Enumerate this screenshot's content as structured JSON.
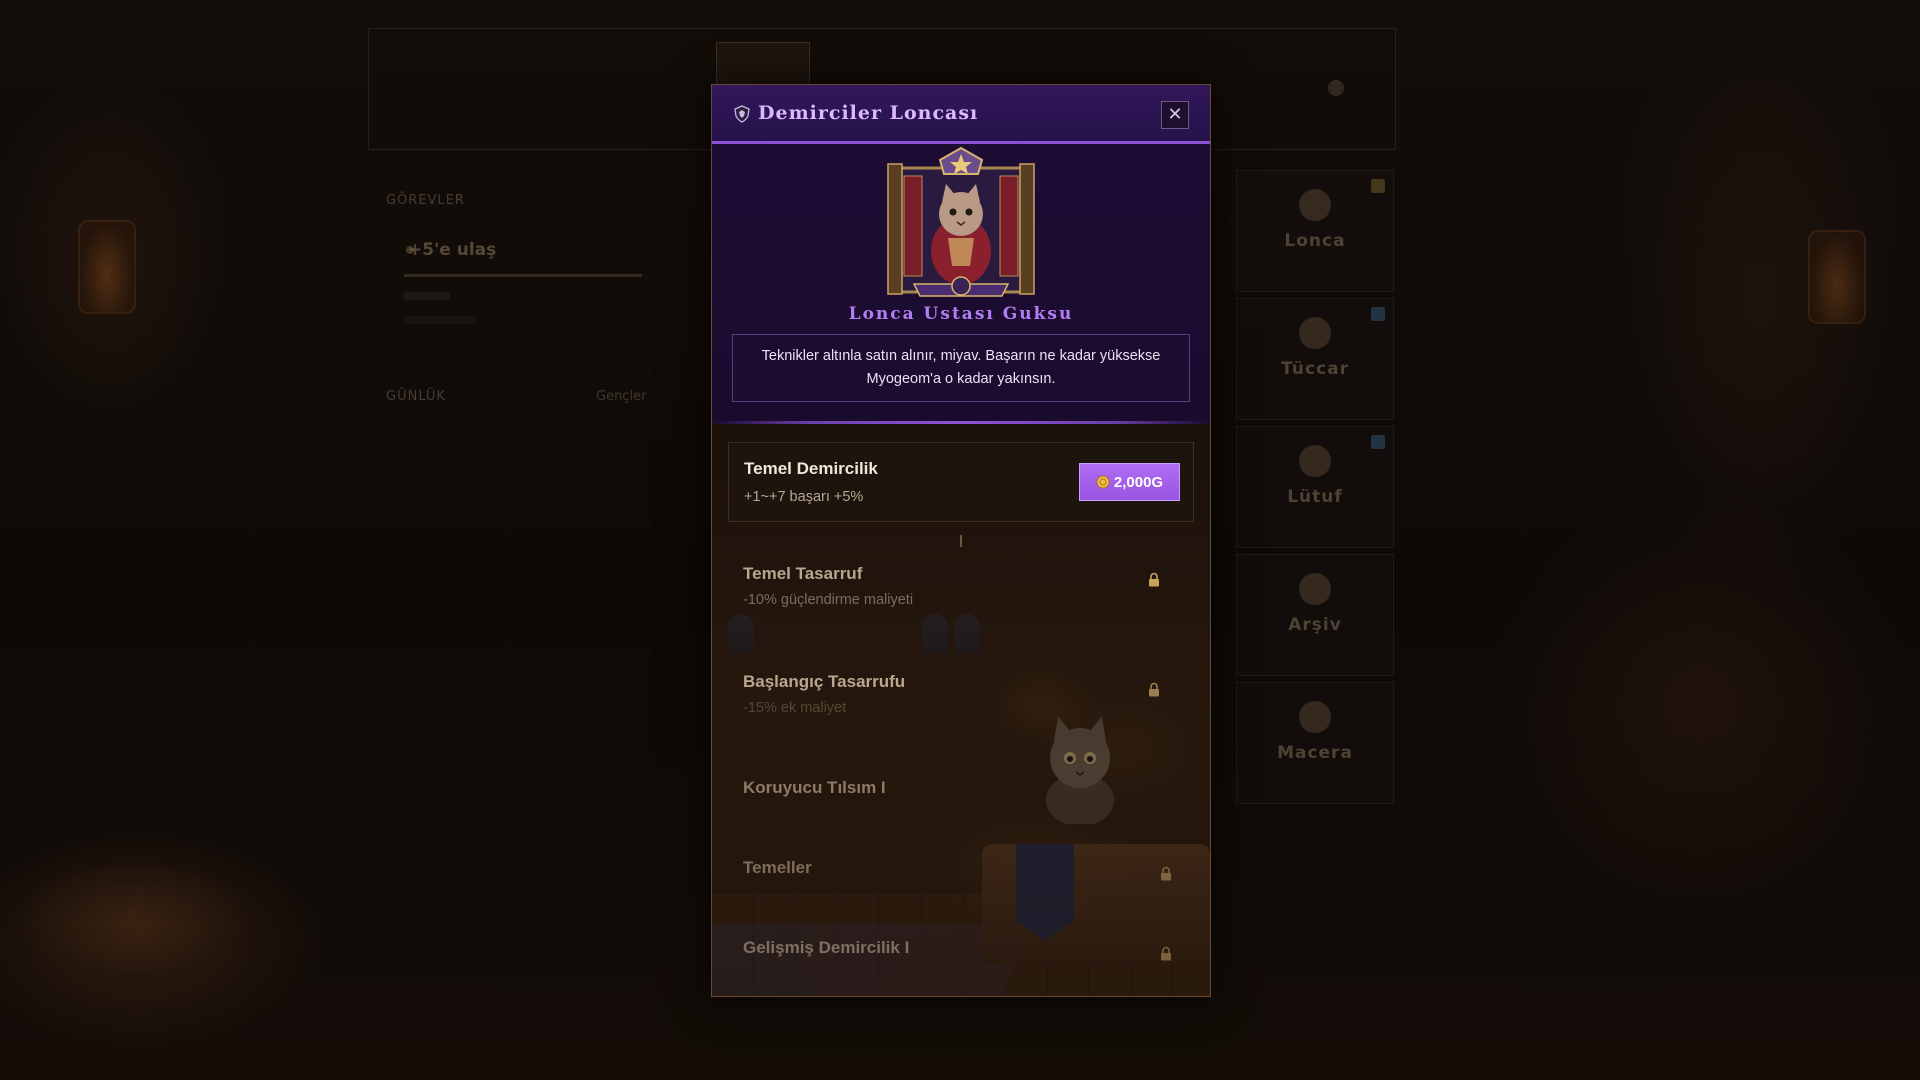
{
  "background": {
    "left_panel": {
      "quests_title": "GÖREVLER",
      "quest_text": "+5'e ulaş",
      "daily_title": "GÜNLÜK",
      "daily_right": "Gençler"
    },
    "side_buttons": [
      {
        "label": "Lonca",
        "icon": "guild-icon",
        "badge": "gold"
      },
      {
        "label": "Tüccar",
        "icon": "merchant-icon",
        "badge": "blue"
      },
      {
        "label": "Lütuf",
        "icon": "blessing-icon",
        "badge": "blue"
      },
      {
        "label": "Arşiv",
        "icon": "archive-icon",
        "badge": ""
      },
      {
        "label": "Macera",
        "icon": "adventure-icon",
        "badge": ""
      }
    ]
  },
  "modal": {
    "title": "Demirciler Loncası",
    "title_icon": "guild-crest-icon",
    "close_symbol": "✕",
    "master_name": "Lonca Ustası Guksu",
    "speech_line1": "Teknikler altınla satın alınır, miyav. Başarın ne kadar yüksekse",
    "speech_line2": "Myogeom'a o kadar yakınsın.",
    "skills": [
      {
        "name": "Temel Demircilik",
        "desc": "+1~+7 başarı +5%",
        "price": "2,000G",
        "locked": false
      },
      {
        "name": "Temel Tasarruf",
        "desc": "-10% güçlendirme maliyeti",
        "locked": true
      },
      {
        "name": "Başlangıç Tasarrufu",
        "desc": "-15% ek maliyet",
        "locked": true
      },
      {
        "name": "Koruyucu Tılsım I",
        "desc": "",
        "locked": true
      },
      {
        "name": "Temeller",
        "desc": "",
        "locked": true
      },
      {
        "name": "Gelişmiş Demircilik I",
        "desc": "",
        "locked": true
      }
    ]
  },
  "colors": {
    "accent_purple": "#9a55e3",
    "title_purple": "#dcb8ff",
    "master_name": "#b27ff3"
  }
}
